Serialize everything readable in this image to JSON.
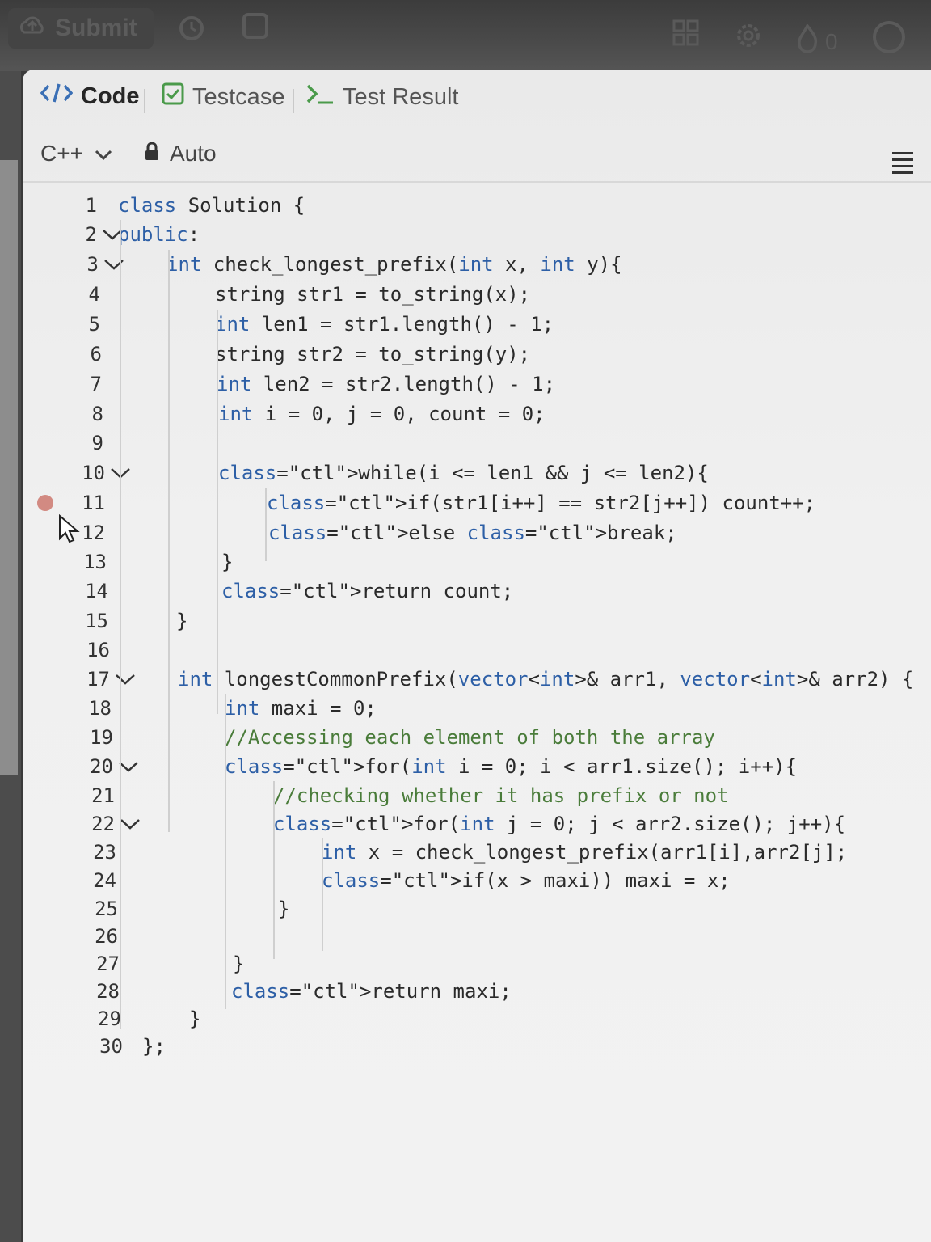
{
  "topbar": {
    "submit_label": "Submit",
    "icons": [
      "cloud-upload-icon",
      "alarm-clock-icon",
      "note-icon",
      "layout-grid-icon",
      "gear-icon",
      "flame-icon"
    ],
    "streak_count": "0"
  },
  "tabs": [
    {
      "label": "Code",
      "icon": "code-icon",
      "active": true
    },
    {
      "label": "Testcase",
      "icon": "checkbox-icon",
      "active": false
    },
    {
      "label": "Test Result",
      "icon": "terminal-icon",
      "active": false
    }
  ],
  "toolbar": {
    "language": "C++",
    "mode": "Auto"
  },
  "editor": {
    "breakpoint_line": "11",
    "lines": [
      {
        "n": "1",
        "fold": false,
        "text": "class Solution {"
      },
      {
        "n": "2",
        "fold": true,
        "text": "public:"
      },
      {
        "n": "3",
        "fold": true,
        "text": "int check_longest_prefix(int x, int y){"
      },
      {
        "n": "4",
        "fold": false,
        "text": "string str1 = to_string(x);"
      },
      {
        "n": "5",
        "fold": false,
        "text": "int len1 = str1.length() - 1;"
      },
      {
        "n": "6",
        "fold": false,
        "text": "string str2 = to_string(y);"
      },
      {
        "n": "7",
        "fold": false,
        "text": "int len2 = str2.length() - 1;"
      },
      {
        "n": "8",
        "fold": false,
        "text": "int i = 0, j = 0, count = 0;"
      },
      {
        "n": "9",
        "fold": false,
        "text": ""
      },
      {
        "n": "10",
        "fold": true,
        "text": "while(i <= len1 && j <= len2){"
      },
      {
        "n": "11",
        "fold": false,
        "text": "if(str1[i++] == str2[j++]) count++;"
      },
      {
        "n": "12",
        "fold": false,
        "text": "else break;"
      },
      {
        "n": "13",
        "fold": false,
        "text": "}"
      },
      {
        "n": "14",
        "fold": false,
        "text": "return count;"
      },
      {
        "n": "15",
        "fold": false,
        "text": "}"
      },
      {
        "n": "16",
        "fold": false,
        "text": ""
      },
      {
        "n": "17",
        "fold": true,
        "text": "int longestCommonPrefix(vector<int>& arr1, vector<int>& arr2) {"
      },
      {
        "n": "18",
        "fold": false,
        "text": "int maxi = 0;"
      },
      {
        "n": "19",
        "fold": false,
        "text": "//Accessing each element of both the array"
      },
      {
        "n": "20",
        "fold": true,
        "text": "for(int i = 0; i < arr1.size(); i++){"
      },
      {
        "n": "21",
        "fold": false,
        "text": "//checking whether it has prefix or not"
      },
      {
        "n": "22",
        "fold": true,
        "text": "for(int j = 0; j < arr2.size(); j++){"
      },
      {
        "n": "23",
        "fold": false,
        "text": "int x = check_longest_prefix(arr1[i],arr2[j];"
      },
      {
        "n": "24",
        "fold": false,
        "text": "if(x > maxi)) maxi = x;"
      },
      {
        "n": "25",
        "fold": false,
        "text": "}"
      },
      {
        "n": "26",
        "fold": false,
        "text": ""
      },
      {
        "n": "27",
        "fold": false,
        "text": "}"
      },
      {
        "n": "28",
        "fold": false,
        "text": "return maxi;"
      },
      {
        "n": "29",
        "fold": false,
        "text": "}"
      },
      {
        "n": "30",
        "fold": false,
        "text": "};"
      }
    ]
  }
}
